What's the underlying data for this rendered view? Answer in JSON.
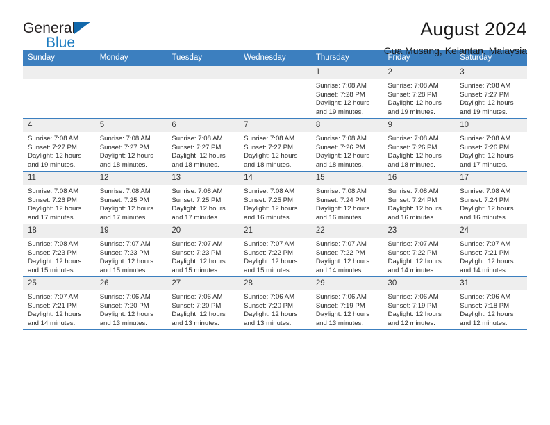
{
  "brand": {
    "line1": "General",
    "line2": "Blue",
    "triangle_color": "#1168ab",
    "blue_color": "#1b7bc0"
  },
  "header": {
    "title": "August 2024",
    "subtitle": "Gua Musang, Kelantan, Malaysia"
  },
  "colors": {
    "header_blue": "#3c7fbf",
    "daynum_gray": "#eeeeee"
  },
  "weekday_headers": [
    "Sunday",
    "Monday",
    "Tuesday",
    "Wednesday",
    "Thursday",
    "Friday",
    "Saturday"
  ],
  "weeks": [
    [
      {
        "day": "",
        "empty": true,
        "lines": []
      },
      {
        "day": "",
        "empty": true,
        "lines": []
      },
      {
        "day": "",
        "empty": true,
        "lines": []
      },
      {
        "day": "",
        "empty": true,
        "lines": []
      },
      {
        "day": "1",
        "empty": false,
        "lines": [
          "Sunrise: 7:08 AM",
          "Sunset: 7:28 PM",
          "Daylight: 12 hours",
          "and 19 minutes."
        ]
      },
      {
        "day": "2",
        "empty": false,
        "lines": [
          "Sunrise: 7:08 AM",
          "Sunset: 7:28 PM",
          "Daylight: 12 hours",
          "and 19 minutes."
        ]
      },
      {
        "day": "3",
        "empty": false,
        "lines": [
          "Sunrise: 7:08 AM",
          "Sunset: 7:27 PM",
          "Daylight: 12 hours",
          "and 19 minutes."
        ]
      }
    ],
    [
      {
        "day": "4",
        "empty": false,
        "lines": [
          "Sunrise: 7:08 AM",
          "Sunset: 7:27 PM",
          "Daylight: 12 hours",
          "and 19 minutes."
        ]
      },
      {
        "day": "5",
        "empty": false,
        "lines": [
          "Sunrise: 7:08 AM",
          "Sunset: 7:27 PM",
          "Daylight: 12 hours",
          "and 18 minutes."
        ]
      },
      {
        "day": "6",
        "empty": false,
        "lines": [
          "Sunrise: 7:08 AM",
          "Sunset: 7:27 PM",
          "Daylight: 12 hours",
          "and 18 minutes."
        ]
      },
      {
        "day": "7",
        "empty": false,
        "lines": [
          "Sunrise: 7:08 AM",
          "Sunset: 7:27 PM",
          "Daylight: 12 hours",
          "and 18 minutes."
        ]
      },
      {
        "day": "8",
        "empty": false,
        "lines": [
          "Sunrise: 7:08 AM",
          "Sunset: 7:26 PM",
          "Daylight: 12 hours",
          "and 18 minutes."
        ]
      },
      {
        "day": "9",
        "empty": false,
        "lines": [
          "Sunrise: 7:08 AM",
          "Sunset: 7:26 PM",
          "Daylight: 12 hours",
          "and 18 minutes."
        ]
      },
      {
        "day": "10",
        "empty": false,
        "lines": [
          "Sunrise: 7:08 AM",
          "Sunset: 7:26 PM",
          "Daylight: 12 hours",
          "and 17 minutes."
        ]
      }
    ],
    [
      {
        "day": "11",
        "empty": false,
        "lines": [
          "Sunrise: 7:08 AM",
          "Sunset: 7:26 PM",
          "Daylight: 12 hours",
          "and 17 minutes."
        ]
      },
      {
        "day": "12",
        "empty": false,
        "lines": [
          "Sunrise: 7:08 AM",
          "Sunset: 7:25 PM",
          "Daylight: 12 hours",
          "and 17 minutes."
        ]
      },
      {
        "day": "13",
        "empty": false,
        "lines": [
          "Sunrise: 7:08 AM",
          "Sunset: 7:25 PM",
          "Daylight: 12 hours",
          "and 17 minutes."
        ]
      },
      {
        "day": "14",
        "empty": false,
        "lines": [
          "Sunrise: 7:08 AM",
          "Sunset: 7:25 PM",
          "Daylight: 12 hours",
          "and 16 minutes."
        ]
      },
      {
        "day": "15",
        "empty": false,
        "lines": [
          "Sunrise: 7:08 AM",
          "Sunset: 7:24 PM",
          "Daylight: 12 hours",
          "and 16 minutes."
        ]
      },
      {
        "day": "16",
        "empty": false,
        "lines": [
          "Sunrise: 7:08 AM",
          "Sunset: 7:24 PM",
          "Daylight: 12 hours",
          "and 16 minutes."
        ]
      },
      {
        "day": "17",
        "empty": false,
        "lines": [
          "Sunrise: 7:08 AM",
          "Sunset: 7:24 PM",
          "Daylight: 12 hours",
          "and 16 minutes."
        ]
      }
    ],
    [
      {
        "day": "18",
        "empty": false,
        "lines": [
          "Sunrise: 7:08 AM",
          "Sunset: 7:23 PM",
          "Daylight: 12 hours",
          "and 15 minutes."
        ]
      },
      {
        "day": "19",
        "empty": false,
        "lines": [
          "Sunrise: 7:07 AM",
          "Sunset: 7:23 PM",
          "Daylight: 12 hours",
          "and 15 minutes."
        ]
      },
      {
        "day": "20",
        "empty": false,
        "lines": [
          "Sunrise: 7:07 AM",
          "Sunset: 7:23 PM",
          "Daylight: 12 hours",
          "and 15 minutes."
        ]
      },
      {
        "day": "21",
        "empty": false,
        "lines": [
          "Sunrise: 7:07 AM",
          "Sunset: 7:22 PM",
          "Daylight: 12 hours",
          "and 15 minutes."
        ]
      },
      {
        "day": "22",
        "empty": false,
        "lines": [
          "Sunrise: 7:07 AM",
          "Sunset: 7:22 PM",
          "Daylight: 12 hours",
          "and 14 minutes."
        ]
      },
      {
        "day": "23",
        "empty": false,
        "lines": [
          "Sunrise: 7:07 AM",
          "Sunset: 7:22 PM",
          "Daylight: 12 hours",
          "and 14 minutes."
        ]
      },
      {
        "day": "24",
        "empty": false,
        "lines": [
          "Sunrise: 7:07 AM",
          "Sunset: 7:21 PM",
          "Daylight: 12 hours",
          "and 14 minutes."
        ]
      }
    ],
    [
      {
        "day": "25",
        "empty": false,
        "lines": [
          "Sunrise: 7:07 AM",
          "Sunset: 7:21 PM",
          "Daylight: 12 hours",
          "and 14 minutes."
        ]
      },
      {
        "day": "26",
        "empty": false,
        "lines": [
          "Sunrise: 7:06 AM",
          "Sunset: 7:20 PM",
          "Daylight: 12 hours",
          "and 13 minutes."
        ]
      },
      {
        "day": "27",
        "empty": false,
        "lines": [
          "Sunrise: 7:06 AM",
          "Sunset: 7:20 PM",
          "Daylight: 12 hours",
          "and 13 minutes."
        ]
      },
      {
        "day": "28",
        "empty": false,
        "lines": [
          "Sunrise: 7:06 AM",
          "Sunset: 7:20 PM",
          "Daylight: 12 hours",
          "and 13 minutes."
        ]
      },
      {
        "day": "29",
        "empty": false,
        "lines": [
          "Sunrise: 7:06 AM",
          "Sunset: 7:19 PM",
          "Daylight: 12 hours",
          "and 13 minutes."
        ]
      },
      {
        "day": "30",
        "empty": false,
        "lines": [
          "Sunrise: 7:06 AM",
          "Sunset: 7:19 PM",
          "Daylight: 12 hours",
          "and 12 minutes."
        ]
      },
      {
        "day": "31",
        "empty": false,
        "lines": [
          "Sunrise: 7:06 AM",
          "Sunset: 7:18 PM",
          "Daylight: 12 hours",
          "and 12 minutes."
        ]
      }
    ]
  ]
}
